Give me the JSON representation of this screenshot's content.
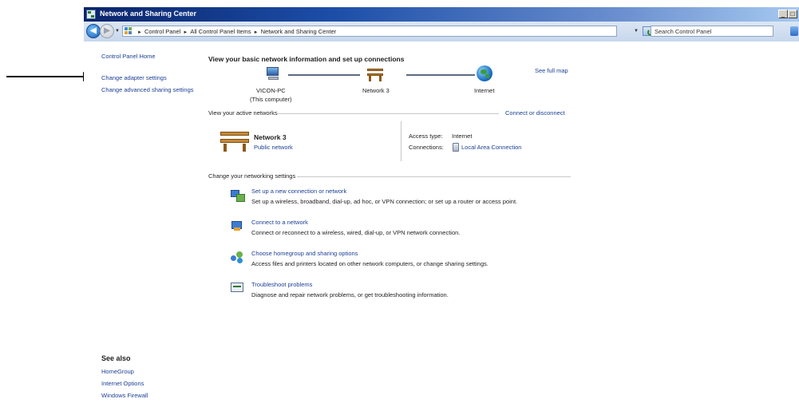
{
  "window": {
    "title": "Network and Sharing Center",
    "controls": {
      "minimize": "_",
      "maximize": "□",
      "close": "x"
    }
  },
  "navbar": {
    "breadcrumbs": [
      "Control Panel",
      "All Control Panel Items",
      "Network and Sharing Center"
    ],
    "search_placeholder": "Search Control Panel"
  },
  "sidebar": {
    "home": "Control Panel Home",
    "links": [
      "Change adapter settings",
      "Change advanced sharing settings"
    ],
    "see_also_heading": "See also",
    "see_also": [
      "HomeGroup",
      "Internet Options",
      "Windows Firewall"
    ]
  },
  "main": {
    "heading": "View your basic network information and set up connections",
    "see_full_map": "See full map",
    "map": {
      "computer_name": "VICON-PC",
      "computer_sub": "(This computer)",
      "network_name": "Network  3",
      "internet": "Internet"
    },
    "active_networks": {
      "label": "View your active networks",
      "connect_link": "Connect or disconnect",
      "network_title": "Network  3",
      "network_type": "Public network",
      "access_type_label": "Access type:",
      "access_type_value": "Internet",
      "connections_label": "Connections:",
      "connections_value": "Local Area Connection"
    },
    "change_settings": {
      "label": "Change your networking settings",
      "tasks": [
        {
          "title": "Set up a new connection or network",
          "desc": "Set up a wireless, broadband, dial-up, ad hoc, or VPN connection; or set up a router or access point.",
          "icon": "new-connection-icon"
        },
        {
          "title": "Connect to a network",
          "desc": "Connect or reconnect to a wireless, wired, dial-up, or VPN network connection.",
          "icon": "connect-network-icon"
        },
        {
          "title": "Choose homegroup and sharing options",
          "desc": "Access files and printers located on other network computers, or change sharing settings.",
          "icon": "homegroup-icon"
        },
        {
          "title": "Troubleshoot problems",
          "desc": "Diagnose and repair network problems, or get troubleshooting information.",
          "icon": "troubleshoot-icon"
        }
      ]
    }
  }
}
